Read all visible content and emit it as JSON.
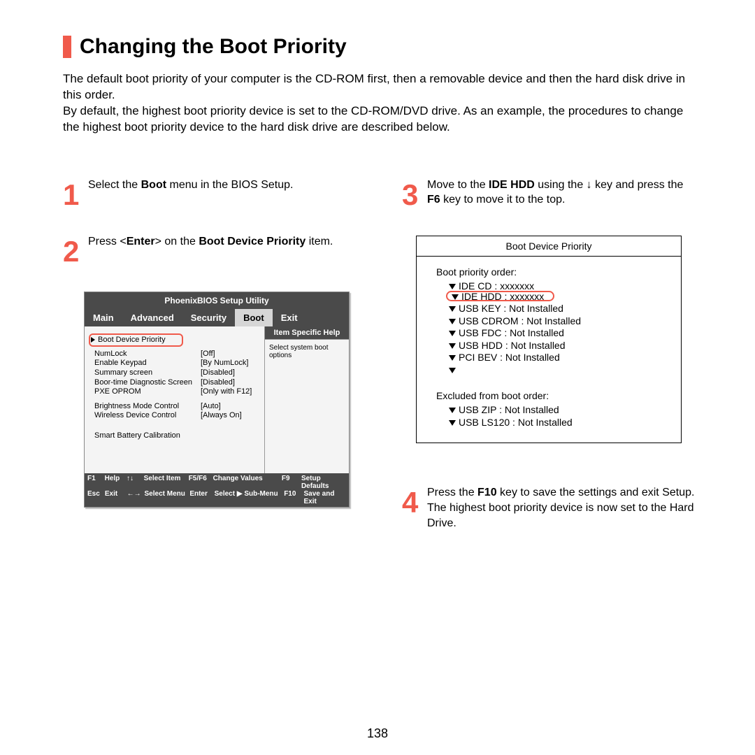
{
  "page_number": "138",
  "title": "Changing the Boot Priority",
  "intro1": "The default boot priority of your computer is the CD-ROM first, then a removable device and then the hard disk drive in this order.",
  "intro2": "By default, the highest boot priority device is set to the CD-ROM/DVD drive. As an example, the procedures to change the highest boot priority device to the hard disk drive are described below.",
  "steps": {
    "s1_a": "Select the ",
    "s1_b": "Boot",
    "s1_c": " menu in the BIOS Setup.",
    "s2_a": "Press <",
    "s2_b": "Enter",
    "s2_c": "> on the ",
    "s2_d": "Boot Device Priority",
    "s2_e": " item.",
    "s3_a": "Move to the ",
    "s3_b": "IDE HDD",
    "s3_c": " using the ↓ key and press the ",
    "s3_d": "F6",
    "s3_e": " key to move it to the top.",
    "s4_a": "Press the ",
    "s4_b": "F10",
    "s4_c": " key to save the settings and exit Setup. The highest boot priority device is now set to the Hard Drive."
  },
  "bios": {
    "title": "PhoenixBIOS Setup Utility",
    "tabs": [
      "Main",
      "Advanced",
      "Security",
      "Boot",
      "Exit"
    ],
    "highlight_row": "Boot Device Priority",
    "rows": [
      {
        "label": "NumLock",
        "val": "[Off]"
      },
      {
        "label": "Enable Keypad",
        "val": "[By NumLock]"
      },
      {
        "label": "Summary screen",
        "val": "[Disabled]"
      },
      {
        "label": "Boor-time Diagnostic Screen",
        "val": "[Disabled]"
      },
      {
        "label": "PXE OPROM",
        "val": "[Only with F12]"
      }
    ],
    "rows2": [
      {
        "label": "Brightness Mode Control",
        "val": "[Auto]"
      },
      {
        "label": "Wireless Device Control",
        "val": "[Always On]"
      }
    ],
    "rows3": [
      {
        "label": "Smart Battery Calibration",
        "val": ""
      }
    ],
    "help_title": "Item Specific Help",
    "help_body": "Select system boot options",
    "footer": {
      "f1": {
        "k1": "F1",
        "l1": "Help",
        "k2": "↑↓",
        "l2": "Select Item",
        "k3": "F5/F6",
        "l3": "Change Values",
        "k4": "F9",
        "l4": "Setup Defaults"
      },
      "f2": {
        "k1": "Esc",
        "l1": "Exit",
        "k2": "←→",
        "l2": "Select Menu",
        "k3": "Enter",
        "l3": "Select ▶ Sub-Menu",
        "k4": "F10",
        "l4": "Save and Exit"
      }
    }
  },
  "priority": {
    "title": "Boot Device Priority",
    "section1": "Boot priority order:",
    "items1": [
      "IDE CD : xxxxxxx",
      "IDE HDD : xxxxxxx",
      "USB KEY : Not Installed",
      "USB CDROM : Not Installed",
      "USB FDC : Not Installed",
      "USB HDD : Not Installed",
      "PCI BEV : Not Installed",
      ""
    ],
    "section2": "Excluded from boot order:",
    "items2": [
      "USB ZIP : Not Installed",
      "USB LS120 : Not Installed"
    ]
  }
}
